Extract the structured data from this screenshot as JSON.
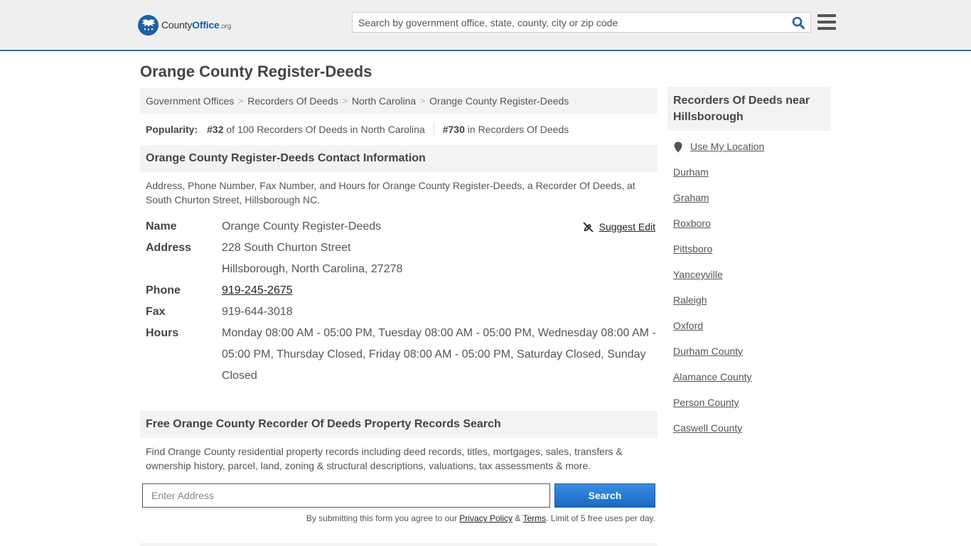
{
  "header": {
    "logo_brand": "County",
    "logo_brand_bold": "Office",
    "logo_tld": ".org",
    "search_placeholder": "Search by government office, state, county, city or zip code"
  },
  "page": {
    "title": "Orange County Register-Deeds"
  },
  "breadcrumb": [
    "Government Offices",
    "Recorders Of Deeds",
    "North Carolina",
    "Orange County Register-Deeds"
  ],
  "popularity": {
    "label": "Popularity:",
    "rank_state": "#32",
    "rank_state_text": "of 100 Recorders Of Deeds in North Carolina",
    "rank_national": "#730",
    "rank_national_text": "in Recorders Of Deeds"
  },
  "contact": {
    "heading": "Orange County Register-Deeds Contact Information",
    "description": "Address, Phone Number, Fax Number, and Hours for Orange County Register-Deeds, a Recorder Of Deeds, at South Churton Street, Hillsborough NC.",
    "suggest_edit": "Suggest Edit",
    "labels": {
      "name": "Name",
      "address": "Address",
      "phone": "Phone",
      "fax": "Fax",
      "hours": "Hours"
    },
    "name": "Orange County Register-Deeds",
    "address_line1": "228 South Churton Street",
    "address_line2": "Hillsborough, North Carolina, 27278",
    "phone": "919-245-2675",
    "fax": "919-644-3018",
    "hours": "Monday 08:00 AM - 05:00 PM, Tuesday 08:00 AM - 05:00 PM, Wednesday 08:00 AM - 05:00 PM, Thursday Closed, Friday 08:00 AM - 05:00 PM, Saturday Closed, Sunday Closed"
  },
  "records": {
    "heading": "Free Orange County Recorder Of Deeds Property Records Search",
    "description": "Find Orange County residential property records including deed records, titles, mortgages, sales, transfers & ownership history, parcel, land, zoning & structural descriptions, valuations, tax assessments & more.",
    "input_placeholder": "Enter Address",
    "button": "Search",
    "disclaimer_pre": "By submitting this form you agree to our",
    "privacy": "Privacy Policy",
    "amp": "&",
    "terms": "Terms",
    "disclaimer_post": ". Limit of 5 free uses per day."
  },
  "sidebar": {
    "heading": "Recorders Of Deeds near Hillsborough",
    "use_location": "Use My Location",
    "links": [
      "Durham",
      "Graham",
      "Roxboro",
      "Pittsboro",
      "Yanceyville",
      "Raleigh",
      "Oxford",
      "Durham County",
      "Alamance County",
      "Person County",
      "Caswell County"
    ]
  },
  "colors": {
    "accent": "#1e73be",
    "button": "#1a69c4",
    "panel": "#f3f3f3"
  }
}
